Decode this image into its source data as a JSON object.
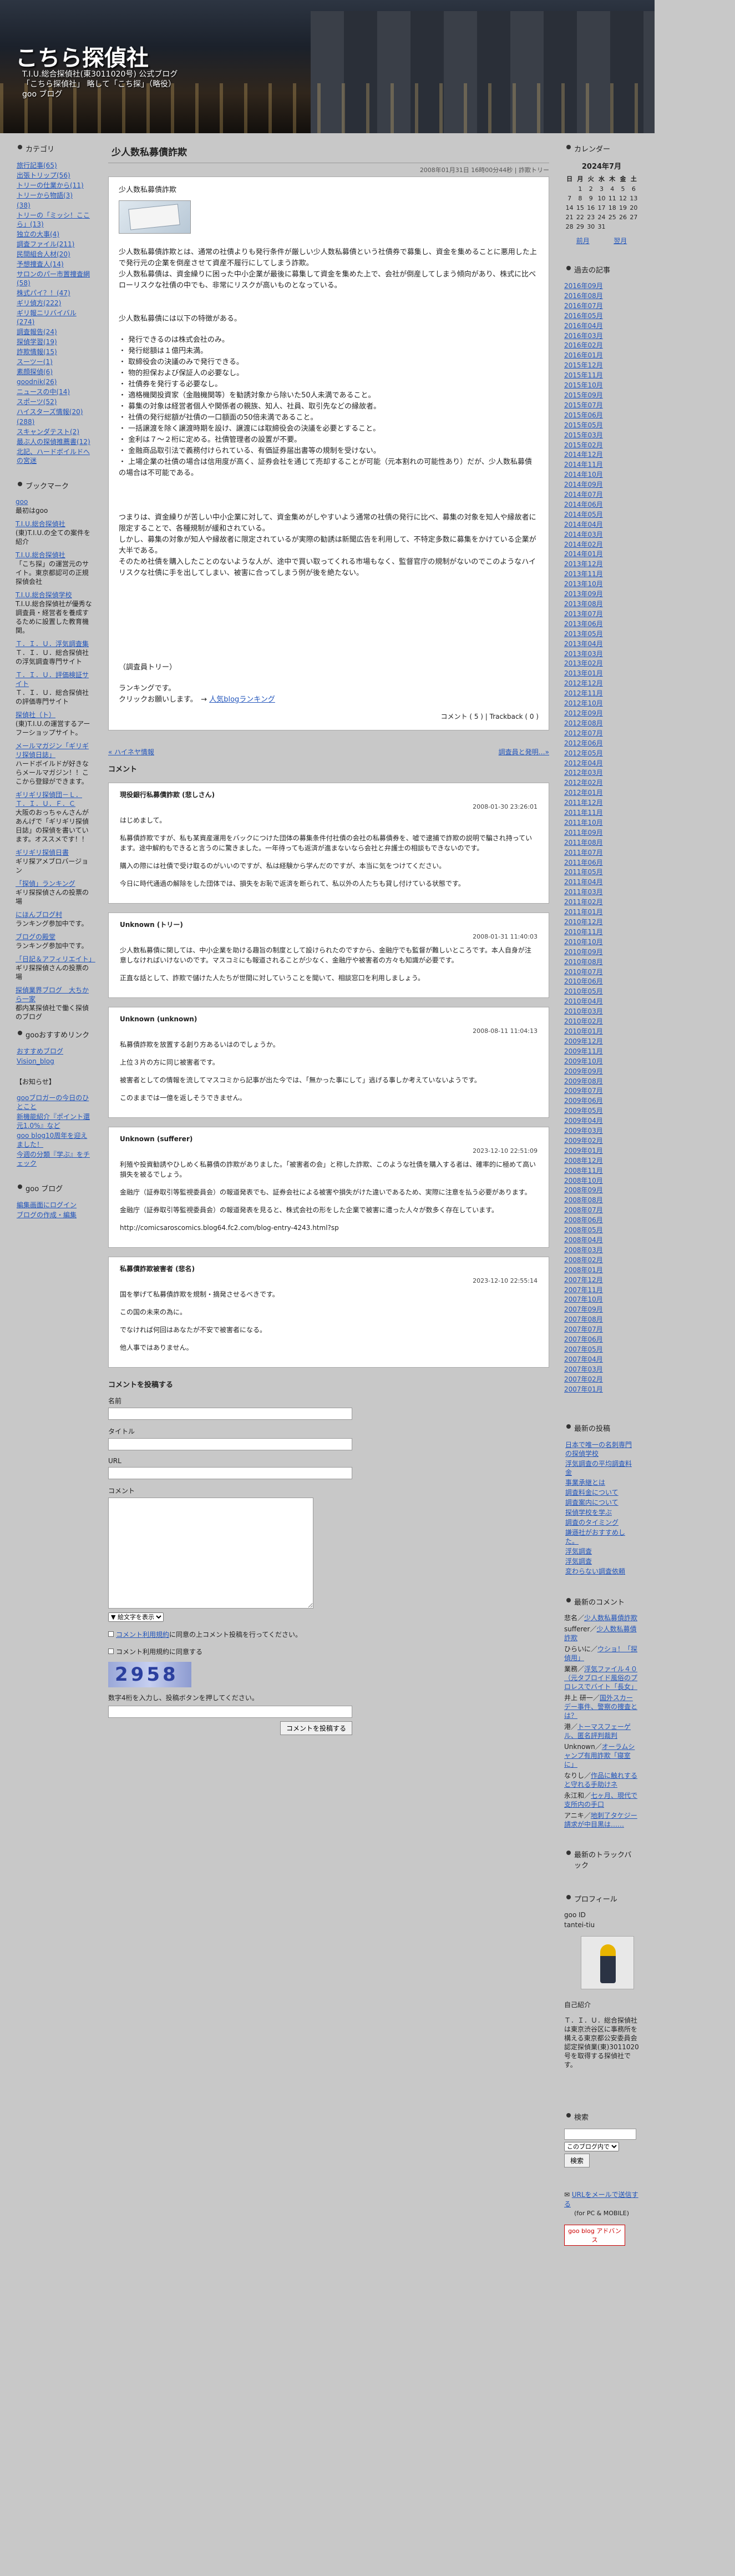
{
  "header": {
    "title": "こちら探偵社",
    "desc": "T.I.U.総合探偵社(東3011020号) 公式ブログ「こちら探偵社」 略して「こち探」（略役）goo ブログ"
  },
  "left": {
    "category_h": "カテゴリ",
    "categories": [
      "旅行記事(65)",
      "出張トリップ(56)",
      "トリーの仕業から(11)",
      "トリーから物語(3)",
      "(38)",
      "トリーの「ミッシ！ここら」(13)",
      "独立の大事(4)",
      "調査ファイル(211)",
      "民間組合人材(20)",
      "予想捜査人(14)",
      "サロンのパー市置捜査網(58)",
      "株式パイ？！(47)",
      "ギリ偵方(222)",
      "ギリ報ニリバイバル(274)",
      "調査報告(24)",
      "探偵学習(19)",
      "詐欺情報(15)",
      "スーツー(1)",
      "素顔探偵(6)",
      "goodnik(26)",
      "ニュースの中(14)",
      "スポーツ(52)",
      "ハイスターズ情報(20)",
      "(288)",
      "スキャンダテスト(2)",
      "最ぶ人の探偵推薦書(12)",
      "北記、ハードボイルドへの宮迷"
    ],
    "bookmark_h": "ブックマーク",
    "bookmarks": [
      {
        "link": "goo",
        "note": "最初はgoo"
      },
      {
        "link": "T.I.U.総合探偵社",
        "note": "(東)T.I.U.の全ての案件を紹介"
      },
      {
        "link": "T.I.U.総合探偵社",
        "note": "「こち探」の運営元のサイト。東京都認可の正規探偵会社"
      },
      {
        "link": "T.I.U.総合探偵学校",
        "note": "T.I.U.総合探偵社が優秀な調査員・経営者を養成するために設置した教育機関。"
      },
      {
        "link": "Ｔ．Ｉ．Ｕ．浮気調査集",
        "note": "Ｔ．Ｉ．Ｕ．総合探偵社の浮気調査専門サイト"
      },
      {
        "link": "Ｔ．Ｉ．Ｕ．評価検証サイト",
        "note": "Ｔ．Ｉ．Ｕ．総合探偵社の評価専門サイト"
      },
      {
        "link": "探偵社（ト）",
        "note": "(東)T.I.U.の運営するアーフーショップサイト。"
      },
      {
        "link": "メールマガジン「ギリギリ探偵日誌」",
        "note": "ハードボイルドが好きならメールマガジン！！ここから登録ができます。"
      },
      {
        "link": "ギリギリ探偵団－Ｌ．Ｔ．Ｉ．Ｕ．Ｆ．Ｃ",
        "note": "大阪のおっちゃんさんがあんげで「ギリギリ探偵日誌」の探偵を書いています。オススメです！！"
      },
      {
        "link": "ギリギリ探偵日書",
        "note": "ギリ探アメブロバージョン"
      },
      {
        "link": "「探偵」ランキング",
        "note": "ギリ探探偵さんの投票の場"
      },
      {
        "link": "にほんブログ村",
        "note": "ランキング参加中です。"
      },
      {
        "link": "ブログの殿堂",
        "note": "ランキング参加中です。"
      },
      {
        "link": "「日記＆アフィリエイト」",
        "note": "ギリ探探偵さんの投票の場"
      },
      {
        "link": "探偵業界ブログ　大ちから一家",
        "note": "都内某探偵社で働く探偵のブログ"
      }
    ],
    "goo_rec_h": "gooおすすめリンク",
    "goo_rec": [
      "おすすめブログ",
      "Vision_blog"
    ],
    "oshirase_h": "【お知らせ】",
    "oshirase": [
      "gooブロガーの今日のひとこと",
      "新機能紹介『ポイント還元1.0%』など",
      "goo blog10周年を迎えました！",
      "今週の分類『学ぶ』をチェック"
    ],
    "goo_blog_h": "goo ブログ",
    "goo_blog": [
      "編集画面にログイン",
      "ブログの作成・編集"
    ]
  },
  "entry": {
    "title": "少人数私募債詐欺",
    "date": "2008年01月31日 16時00分44秒 | 詐欺トリー",
    "box_title": "少人数私募債詐欺",
    "p1": "少人数私募債詐欺とは、通常の社債よりも発行条件が厳しい少人数私募債という社債券で募集し、資金を集めることに悪用した上で発行元の企業を倒産させて資産不履行にしてしまう詐欺。",
    "p1b": "少人数私募債は、資金繰りに困った中小企業が最後に募集して資金を集めた上で、会社が倒産してしまう傾向があり、株式に比べローリスクな社債の中でも、非常にリスクが高いものとなっている。",
    "p2": "少人数私募債には以下の特徴がある。",
    "list": [
      "発行できるのは株式会社のみ。",
      "発行総額は１億円未満。",
      "取締役会の決議のみで発行できる。",
      "物的担保および保証人の必要なし。",
      "社債券を発行する必要なし。",
      "適格機関投資家（金融機関等）を勧誘対象から除いた50人未満であること。",
      "募集の対象は経営者個人や関係者の親族、知人、社員、取引先などの縁故者。",
      "社債の発行総額が社債の一口額面の50倍未満であること。",
      "一括譲渡を除く譲渡時期を設け、譲渡には取締役会の決議を必要とすること。",
      "金利は７〜２桁に定める。社債管理者の設置が不要。",
      "金融商品取引法で義務付けられている、有価証券届出書等の規制を受けない。",
      "上場企業の社債の場合は信用度が高く、証券会社を通じて売却することが可能（元本割れの可能性あり）だが、少人数私募債の場合は不可能である。"
    ],
    "p3": "つまりは、資金繰りが苦しい中小企業に対して、資金集めがしやすいよう通常の社債の発行に比べ、募集の対象を知人や縁故者に限定することで、各種規制が緩和されている。",
    "p3b": "しかし、募集の対象が知人や縁故者に限定されているが実際の勧誘は新聞広告を利用して、不特定多数に募集をかけている企業が大半である。",
    "p3c": "そのため社債を購入したことのないような人が、途中で買い取ってくれる市場もなく、監督官庁の規制がないのでこのようなハイリスクな社債に手を出してしまい、被害に合ってしまう例が後を絶たない。",
    "tree": "（調査員トリー）",
    "rank": "ランキングです。",
    "rank2": "クリックお願いします。　→",
    "rank_link": "人気blogランキング",
    "foot": "コメント ( 5 ) | Trackback ( 0 )"
  },
  "nav": {
    "prev": "« ハイネヤ情報",
    "next": "調査員と発明…»"
  },
  "comments_h": "コメント",
  "comments": [
    {
      "who": "現役銀行私募債詐欺 (悲しさん)",
      "when": "2008-01-30 23:26:01",
      "body": [
        "はじめまして。",
        "私募債詐欺ですが、私も某資産運用をバックにつけた団体の募集条件付社債の会社の私募債券を、嘘で逮捕で詐欺の説明で騙され持っています。途中解約もできると言うのに驚きました。一年待っても返済が進まないなら会社と弁護士の相談もできないのです。",
        "購入の際には社債で受け取るのがいいのですが、私は経験から学んだのですが、本当に気をつけてください。",
        "今日に時代通過の解除をした団体では、損失をお恥で返済を断られて、私以外の人たちも貸し付けている状態です。"
      ]
    },
    {
      "who": "Unknown (トリー)",
      "when": "2008-01-31 11:40:03",
      "body": [
        "少人数私募債に関しては、中小企業を助ける趣旨の制度として設けられたのですから、金融庁でも監督が難しいところです。本人自身が注意しなければいけないのです。マスコミにも報道されることが少なく、金融庁や被害者の方々も知識が必要です。",
        "正直な話として、詐欺で儲けた人たちが世間に対していうことを聞いて、相談窓口を利用しましょう。"
      ]
    },
    {
      "who": "Unknown (unknown)",
      "when": "2008-08-11 11:04:13",
      "body": [
        "私募債詐欺を放置する創り方あるいはのでしょうか。",
        "上位３片の方に同じ被害者です。",
        "被害者としての情報を流してマスコミから記事が出た今では、「無かった事にして」逃げる事しか考えていないようです。",
        "このままでは一億を返しそうできません。"
      ]
    },
    {
      "who": "Unknown (sufferer)",
      "when": "2023-12-10 22:51:09",
      "body": [
        "利殖や投資勧誘やひしめく私募債の詐欺がありました。「被害者の会」と称した詐欺、このような社債を購入する者は、確率的に極めて高い損失を被るでしょう。",
        "金融庁（証券取引等監視委員会）の報道発表でも、証券会社による被害や損失がけた違いであるため、実際に注意を払う必要があります。",
        "金融庁（証券取引等監視委員会）の報道発表を見ると、株式会社の形をした企業で被害に遭った人々が数多く存在しています。",
        "http://comicsaroscomics.blog64.fc2.com/blog-entry-4243.html?sp"
      ]
    },
    {
      "who": "私募債詐欺被害者 (悲名)",
      "when": "2023-12-10 22:55:14",
      "body": [
        "国を挙げて私募債詐欺を規制・摘発させるべきです。",
        "この国の未来の為に。",
        "でなければ何回はあなたが不安で被害者になる。",
        "他人事ではありません。"
      ]
    }
  ],
  "form": {
    "title": "コメントを投稿する",
    "name_label": "名前",
    "title_label": "タイトル",
    "url_label": "URL",
    "comment_label": "コメント",
    "emoji_select": "▼ 絵文字を表示",
    "terms_link": "コメント利用規約",
    "terms_text": "に同意の上コメント投稿を行ってください。",
    "remember": "コメント利用規約に同意する",
    "captcha_text": "2958",
    "captcha_note": "数字4桁を入力し、投稿ボタンを押してください。",
    "submit": "コメントを投稿する"
  },
  "right": {
    "calendar_h": "カレンダー",
    "month": "2024年7月",
    "week": [
      "日",
      "月",
      "火",
      "水",
      "木",
      "金",
      "土"
    ],
    "rows": [
      [
        "",
        "1",
        "2",
        "3",
        "4",
        "5",
        "6"
      ],
      [
        "7",
        "8",
        "9",
        "10",
        "11",
        "12",
        "13"
      ],
      [
        "14",
        "15",
        "16",
        "17",
        "18",
        "19",
        "20"
      ],
      [
        "21",
        "22",
        "23",
        "24",
        "25",
        "26",
        "27"
      ],
      [
        "28",
        "29",
        "30",
        "31",
        "",
        "",
        ""
      ]
    ],
    "prev": "前月",
    "next": "翌月",
    "archive_h": "過去の記事",
    "archive": [
      "2016年09月",
      "2016年08月",
      "2016年07月",
      "2016年05月",
      "2016年04月",
      "2016年03月",
      "2016年02月",
      "2016年01月",
      "2015年12月",
      "2015年11月",
      "2015年10月",
      "2015年09月",
      "2015年07月",
      "2015年06月",
      "2015年05月",
      "2015年03月",
      "2015年02月",
      "2014年12月",
      "2014年11月",
      "2014年10月",
      "2014年09月",
      "2014年07月",
      "2014年06月",
      "2014年05月",
      "2014年04月",
      "2014年03月",
      "2014年02月",
      "2014年01月",
      "2013年12月",
      "2013年11月",
      "2013年10月",
      "2013年09月",
      "2013年08月",
      "2013年07月",
      "2013年06月",
      "2013年05月",
      "2013年04月",
      "2013年03月",
      "2013年02月",
      "2013年01月",
      "2012年12月",
      "2012年11月",
      "2012年10月",
      "2012年09月",
      "2012年08月",
      "2012年07月",
      "2012年06月",
      "2012年05月",
      "2012年04月",
      "2012年03月",
      "2012年02月",
      "2012年01月",
      "2011年12月",
      "2011年11月",
      "2011年10月",
      "2011年09月",
      "2011年08月",
      "2011年07月",
      "2011年06月",
      "2011年05月",
      "2011年04月",
      "2011年03月",
      "2011年02月",
      "2011年01月",
      "2010年12月",
      "2010年11月",
      "2010年10月",
      "2010年09月",
      "2010年08月",
      "2010年07月",
      "2010年06月",
      "2010年05月",
      "2010年04月",
      "2010年03月",
      "2010年02月",
      "2010年01月",
      "2009年12月",
      "2009年11月",
      "2009年10月",
      "2009年09月",
      "2009年08月",
      "2009年07月",
      "2009年06月",
      "2009年05月",
      "2009年04月",
      "2009年03月",
      "2009年02月",
      "2009年01月",
      "2008年12月",
      "2008年11月",
      "2008年10月",
      "2008年09月",
      "2008年08月",
      "2008年07月",
      "2008年06月",
      "2008年05月",
      "2008年04月",
      "2008年03月",
      "2008年02月",
      "2008年01月",
      "2007年12月",
      "2007年11月",
      "2007年10月",
      "2007年09月",
      "2007年08月",
      "2007年07月",
      "2007年06月",
      "2007年05月",
      "2007年04月",
      "2007年03月",
      "2007年02月",
      "2007年01月"
    ],
    "recent_h": "最新の投稿",
    "recent": [
      "日本で唯一の名刺専門の探偵学校",
      "浮気調査の平均調査料金",
      "事業承継とは",
      "調査料金について",
      "調査案内について",
      "探偵学校を学ぶ",
      "調査のタイミング",
      "謙遜社がおすすめした。",
      "浮気調査",
      "浮気調査",
      "変わらない調査依頼"
    ],
    "recent_c_h": "最新のコメント",
    "recent_c": [
      {
        "who": "悲名",
        "on": "少人数私募債詐欺"
      },
      {
        "who": "sufferer",
        "on": "少人数私募債詐欺"
      },
      {
        "who": "ひらいに",
        "on": "ウショ！「探偵用」"
      },
      {
        "who": "業務",
        "on": "浮気ファイル４０（元タブロイド風俗のプロレスでバイト「長女」"
      },
      {
        "who": "井上 研一",
        "on": "国外スカーデー事件、警察の捜査とは？"
      },
      {
        "who": "港",
        "on": "トーマスフェーゲル、匿名評判裁判"
      },
      {
        "who": "Unknown",
        "on": "オーラムシャンプ有用詐欺「寝室に」"
      },
      {
        "who": "なりし",
        "on": "作品に触れすると守れる手助けネ"
      },
      {
        "who": "永江和",
        "on": "七ヶ月、現代で支所内の手口"
      },
      {
        "who": "アニキ",
        "on": "地刺了タケジー請求が中目黒は……"
      }
    ],
    "trackback_h": "最新のトラックバック",
    "profile_h": "プロフィール",
    "goo_id_label": "goo ID",
    "goo_id": "tantei-tiu",
    "self_h": "自己紹介",
    "self": "Ｔ．Ｉ．Ｕ．総合探偵社は東京渋谷区に事務所を構える東京都公安委員会認定探偵業(東)3011020号を取得する探偵社です。",
    "search_h": "検索",
    "search_select": "このブログ内で",
    "search_btn": "検索",
    "rss": "URLをメールで送信する",
    "rss_note": "(for PC & MOBILE)",
    "badge": "goo blog アドバンス"
  }
}
